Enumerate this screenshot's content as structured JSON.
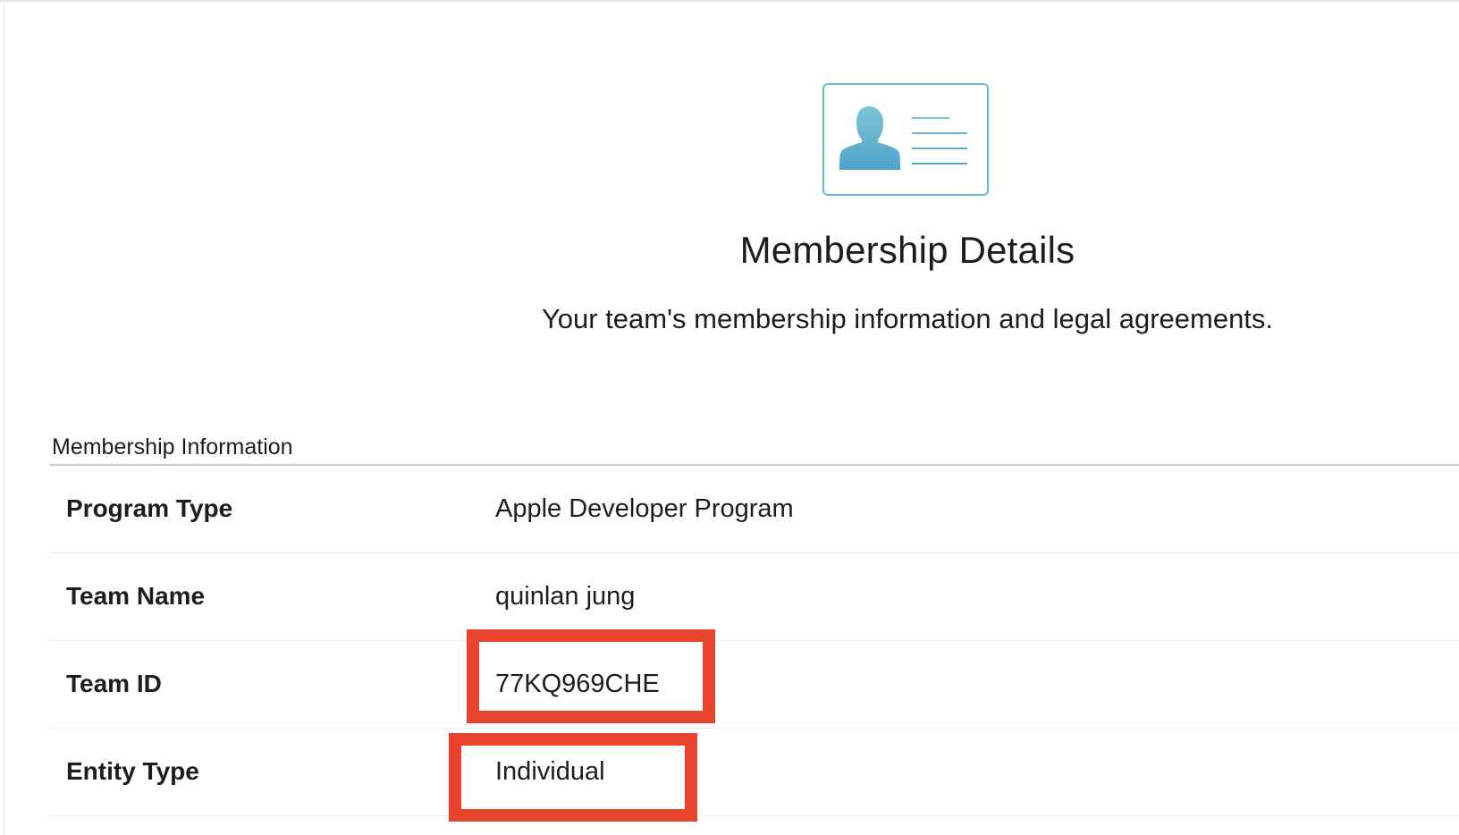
{
  "header": {
    "icon": "member-card-icon",
    "title": "Membership Details",
    "subtitle": "Your team's membership information and legal agreements."
  },
  "section": {
    "heading": "Membership Information",
    "rows": [
      {
        "label": "Program Type",
        "value": "Apple Developer Program"
      },
      {
        "label": "Team Name",
        "value": "quinlan jung"
      },
      {
        "label": "Team ID",
        "value": "77KQ969CHE"
      },
      {
        "label": "Entity Type",
        "value": "Individual"
      }
    ]
  },
  "colors": {
    "icon_accent": "#5aadce",
    "highlight": "#e8432d"
  }
}
